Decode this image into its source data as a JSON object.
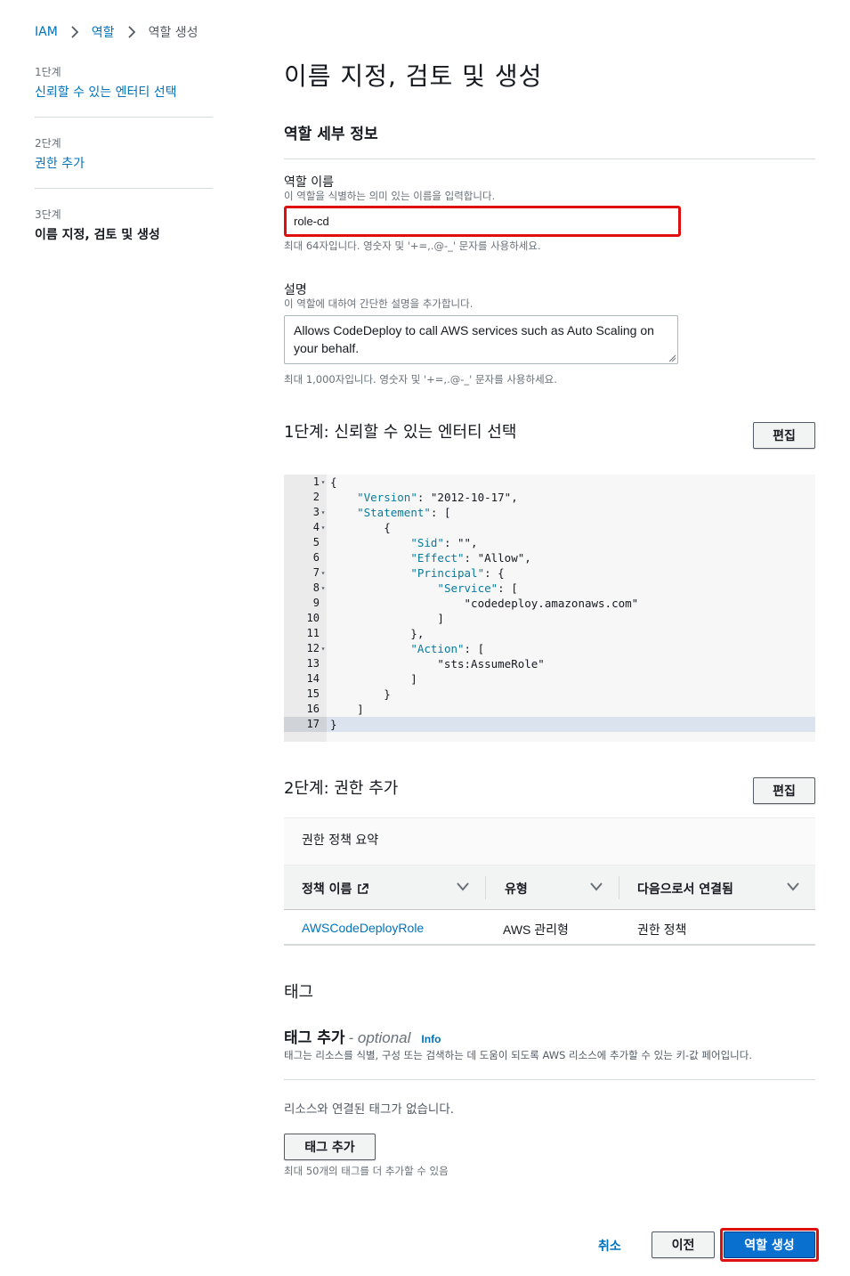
{
  "breadcrumb": {
    "iam": "IAM",
    "roles": "역할",
    "current": "역할 생성"
  },
  "steps": [
    {
      "num": "1단계",
      "label": "신뢰할 수 있는 엔터티 선택"
    },
    {
      "num": "2단계",
      "label": "권한 추가"
    },
    {
      "num": "3단계",
      "label": "이름 지정, 검토 및 생성"
    }
  ],
  "page_title": "이름 지정, 검토 및 생성",
  "role_details": {
    "title": "역할 세부 정보",
    "name_label": "역할 이름",
    "name_desc": "이 역할을 식별하는 의미 있는 이름을 입력합니다.",
    "name_value": "role-cd",
    "name_hint": "최대 64자입니다. 영숫자 및 '+=,.@-_' 문자를 사용하세요.",
    "desc_label": "설명",
    "desc_desc": "이 역할에 대하여 간단한 설명을 추가합니다.",
    "desc_value": "Allows CodeDeploy to call AWS services such as Auto Scaling on your behalf.",
    "desc_hint": "최대 1,000자입니다. 영숫자 및 '+=,.@-_' 문자를 사용하세요."
  },
  "step1": {
    "title": "1단계: 신뢰할 수 있는 엔터티 선택",
    "edit": "편집"
  },
  "policy_lines": [
    {
      "n": "1",
      "fold": true,
      "text": "{"
    },
    {
      "n": "2",
      "fold": false,
      "text": "    \"Version\": \"2012-10-17\","
    },
    {
      "n": "3",
      "fold": true,
      "text": "    \"Statement\": ["
    },
    {
      "n": "4",
      "fold": true,
      "text": "        {"
    },
    {
      "n": "5",
      "fold": false,
      "text": "            \"Sid\": \"\","
    },
    {
      "n": "6",
      "fold": false,
      "text": "            \"Effect\": \"Allow\","
    },
    {
      "n": "7",
      "fold": true,
      "text": "            \"Principal\": {"
    },
    {
      "n": "8",
      "fold": true,
      "text": "                \"Service\": ["
    },
    {
      "n": "9",
      "fold": false,
      "text": "                    \"codedeploy.amazonaws.com\""
    },
    {
      "n": "10",
      "fold": false,
      "text": "                ]"
    },
    {
      "n": "11",
      "fold": false,
      "text": "            },"
    },
    {
      "n": "12",
      "fold": true,
      "text": "            \"Action\": ["
    },
    {
      "n": "13",
      "fold": false,
      "text": "                \"sts:AssumeRole\""
    },
    {
      "n": "14",
      "fold": false,
      "text": "            ]"
    },
    {
      "n": "15",
      "fold": false,
      "text": "        }"
    },
    {
      "n": "16",
      "fold": false,
      "text": "    ]"
    },
    {
      "n": "17",
      "fold": false,
      "text": "}"
    }
  ],
  "step2": {
    "title": "2단계: 권한 추가",
    "edit": "편집",
    "summary_title": "권한 정책 요약",
    "columns": [
      "정책 이름",
      "유형",
      "다음으로서 연결됨"
    ],
    "rows": [
      {
        "name": "AWSCodeDeployRole",
        "type": "AWS 관리형",
        "attached": "권한 정책"
      }
    ]
  },
  "tags": {
    "title": "태그",
    "add_title": "태그 추가",
    "optional": "- optional",
    "info": "Info",
    "desc": "태그는 리소스를 식별, 구성 또는 검색하는 데 도움이 되도록 AWS 리소스에 추가할 수 있는 키-값 페어입니다.",
    "none": "리소스와 연결된 태그가 없습니다.",
    "add_button": "태그 추가",
    "hint": "최대 50개의 태그를 더 추가할 수 있음"
  },
  "footer": {
    "cancel": "취소",
    "previous": "이전",
    "create": "역할 생성"
  }
}
